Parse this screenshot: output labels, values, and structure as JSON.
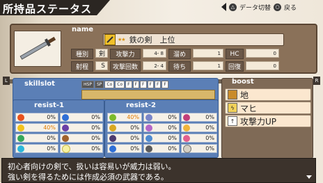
{
  "header": {
    "title": "所持品ステータス",
    "help_buttons": [
      {
        "icon": "triangle-button-icon",
        "label": "データ切替"
      },
      {
        "icon": "circle-button-icon",
        "label": "戻る"
      }
    ]
  },
  "item": {
    "section_label": "name",
    "weapon_icon": "sword-icon",
    "stars": "★★",
    "name": "鉄の剣　上位",
    "stats": [
      [
        {
          "label": "種別",
          "value": "剣"
        },
        {
          "label": "攻撃力",
          "value": "4- 8"
        },
        {
          "label": "溜め",
          "value": "1"
        },
        {
          "label": "HC",
          "value": "0"
        }
      ],
      [
        {
          "label": "射程",
          "value": "S"
        },
        {
          "label": "攻撃回数",
          "value": "2- 4"
        },
        {
          "label": "待ち",
          "value": "1"
        },
        {
          "label": "回復",
          "value": "0"
        }
      ]
    ]
  },
  "skillslot": {
    "label": "skillslot",
    "chips": [
      "HSP",
      "SP",
      "Co",
      "Co",
      "F",
      "F",
      "F",
      "F",
      "F",
      "F"
    ]
  },
  "resist1": {
    "label": "resist-1",
    "rows": [
      [
        {
          "icon": "fire-icon",
          "value": "0%"
        },
        {
          "icon": "water-icon",
          "value": "0%"
        }
      ],
      [
        {
          "icon": "thunder-icon",
          "value": "40%",
          "highlight": true
        },
        {
          "icon": "dark-icon",
          "value": "0%"
        }
      ],
      [
        {
          "icon": "wind-icon",
          "value": "0%"
        },
        {
          "icon": "earth-icon",
          "value": "0%"
        }
      ],
      [
        {
          "icon": "ice-icon",
          "value": "0%"
        },
        {
          "icon": "light-icon",
          "value": "0%"
        }
      ]
    ]
  },
  "resist2": {
    "label": "resist-2",
    "rows": [
      [
        {
          "icon": "poison-icon",
          "value": "40%",
          "highlight": true
        },
        {
          "icon": "sleep-icon",
          "value": "0%"
        },
        {
          "icon": "drink-icon",
          "value": "0%"
        }
      ],
      [
        {
          "icon": "paralysis-icon",
          "value": "0%"
        },
        {
          "icon": "confuse-icon",
          "value": "0%"
        },
        {
          "icon": "stun-icon",
          "value": "0%"
        }
      ],
      [
        {
          "icon": "curse-icon",
          "value": "0%"
        },
        {
          "icon": "seal-icon",
          "value": "0%"
        },
        {
          "icon": "charm-icon",
          "value": "0%"
        }
      ],
      [
        {
          "icon": "silence-icon",
          "value": "0%"
        },
        {
          "icon": "blind-icon",
          "value": "0%"
        },
        {
          "icon": "skull-icon",
          "value": "0%"
        }
      ]
    ]
  },
  "boost": {
    "label": "boost",
    "items": [
      {
        "icon": "earth-icon",
        "label": "地"
      },
      {
        "icon": "lightning-icon",
        "label": "マヒ"
      },
      {
        "icon": "attack-up-icon",
        "label": "攻撃力UP"
      }
    ]
  },
  "description": {
    "line1": "初心者向けの剣で、扱いは容易いが威力は弱い。",
    "line2": "強い剣を得るためには作成必須の武器である。"
  },
  "colors": {
    "panel_brown": "#8a7159",
    "panel_blue": "#5b7fb6",
    "highlight": "#e07a00"
  }
}
